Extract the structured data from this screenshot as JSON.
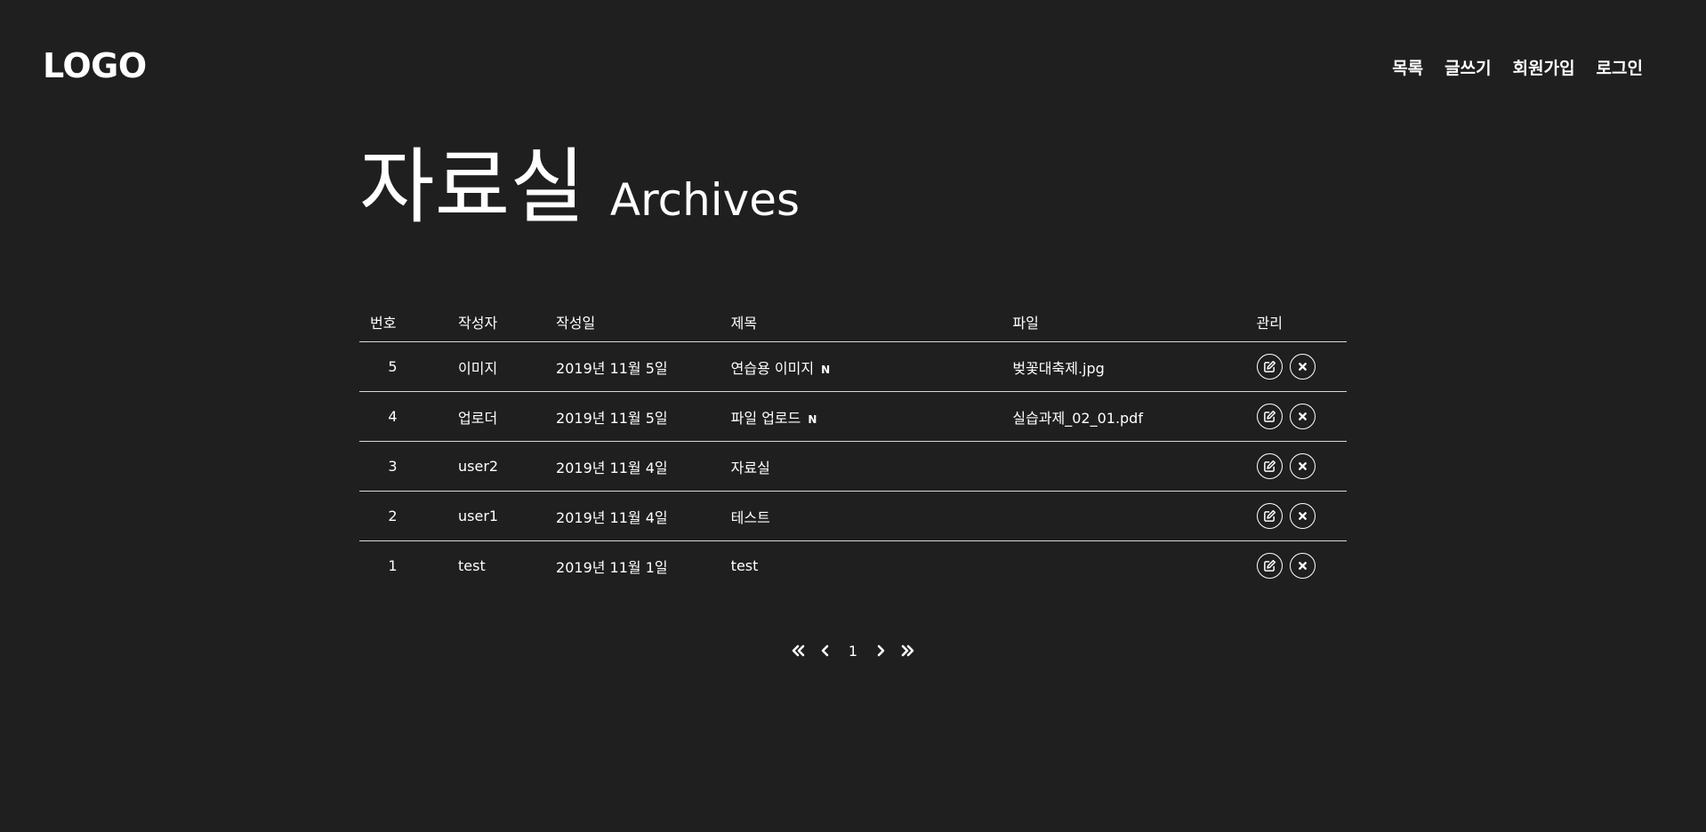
{
  "header": {
    "logo": "LOGO",
    "nav": [
      "목록",
      "글쓰기",
      "회원가입",
      "로그인"
    ]
  },
  "page_title": {
    "korean": "자료실",
    "english": "Archives"
  },
  "table": {
    "columns": [
      "번호",
      "작성자",
      "작성일",
      "제목",
      "파일",
      "관리"
    ],
    "rows": [
      {
        "no": "5",
        "writer": "이미지",
        "date": "2019년 11월 5일",
        "title": "연습용 이미지",
        "badge": "N",
        "file": "벚꽃대축제.jpg"
      },
      {
        "no": "4",
        "writer": "업로더",
        "date": "2019년 11월 5일",
        "title": "파일 업로드",
        "badge": "N",
        "file": "실습과제_02_01.pdf"
      },
      {
        "no": "3",
        "writer": "user2",
        "date": "2019년 11월 4일",
        "title": "자료실",
        "badge": "",
        "file": ""
      },
      {
        "no": "2",
        "writer": "user1",
        "date": "2019년 11월 4일",
        "title": "테스트",
        "badge": "",
        "file": ""
      },
      {
        "no": "1",
        "writer": "test",
        "date": "2019년 11월 1일",
        "title": "test",
        "badge": "",
        "file": ""
      }
    ]
  },
  "pagination": {
    "current_page": "1",
    "icons": [
      "double-chevron-left-icon",
      "chevron-left-icon",
      "chevron-right-icon",
      "double-chevron-right-icon"
    ]
  },
  "colors": {
    "background": "#1f1f1f",
    "text": "#ffffff",
    "divider": "#d9d9d9"
  }
}
